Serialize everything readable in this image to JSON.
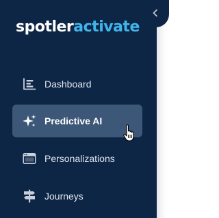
{
  "brand": {
    "logo_part1": "spotler",
    "logo_part2": "activate"
  },
  "collapse_toggle": {
    "icon": "chevron-left-icon"
  },
  "sidebar": {
    "items": [
      {
        "label": "Dashboard",
        "icon": "bar-chart-icon",
        "active": false
      },
      {
        "label": "Predictive AI",
        "icon": "sparkles-icon",
        "active": true
      },
      {
        "label": "Personalizations",
        "icon": "browser-window-icon",
        "active": false
      },
      {
        "label": "Journeys",
        "icon": "signpost-icon",
        "active": false
      }
    ]
  },
  "colors": {
    "sidebar_bg": "#0e2645",
    "active_item_bg": "#3c5777",
    "logo_accent": "#3fb6ec",
    "text": "#dfe6ef"
  }
}
